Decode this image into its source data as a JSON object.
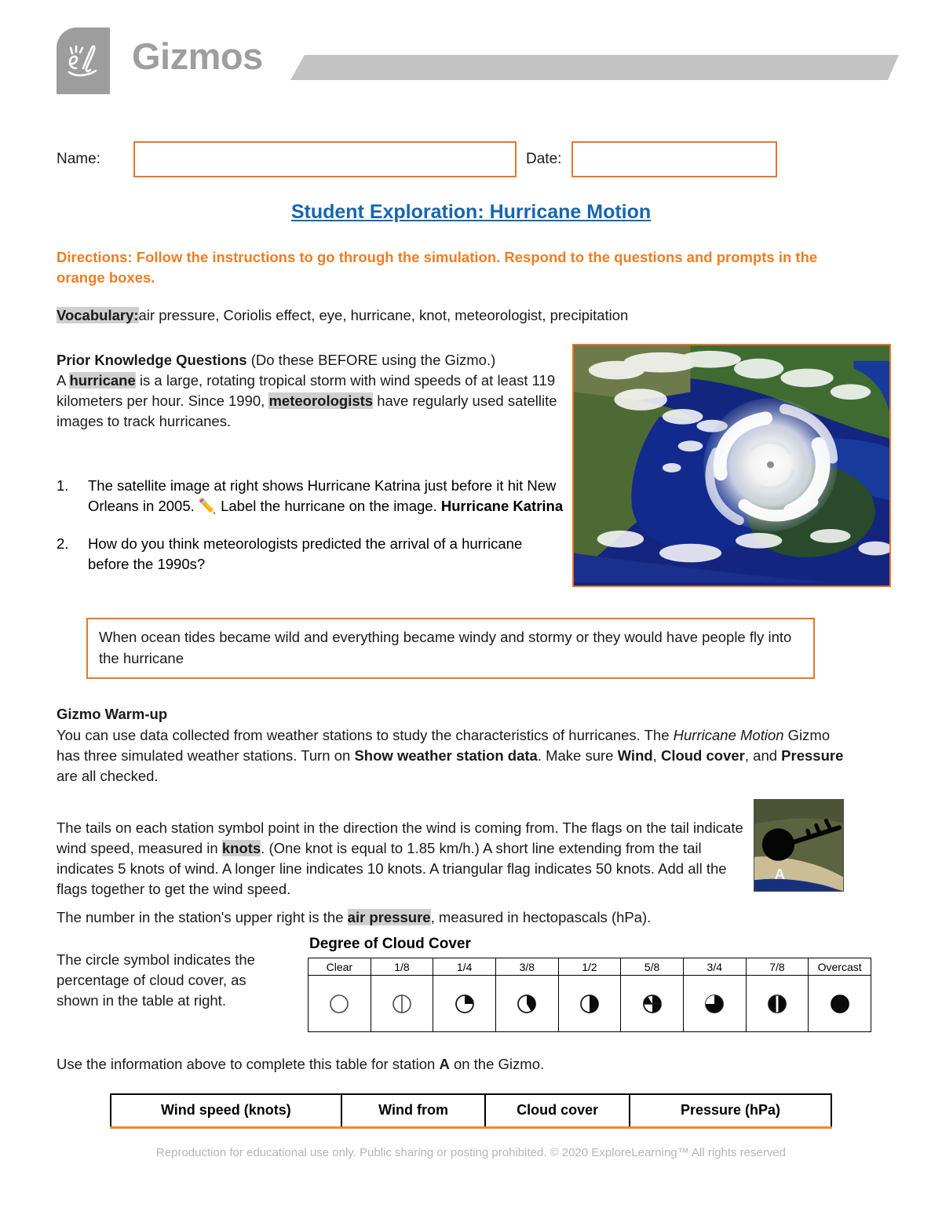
{
  "brand": {
    "logo_text": "Gizmos",
    "logo_mark_label": "el"
  },
  "fields": {
    "name_label": "Name:",
    "name_value": "",
    "date_label": "Date:",
    "date_value": ""
  },
  "title": "Student Exploration: Hurricane Motion",
  "directions": "Directions: Follow the instructions to go through the simulation. Respond to the questions and prompts in the orange boxes.",
  "vocabulary": {
    "label": "Vocabulary:",
    "terms": "air pressure, Coriolis effect, eye, hurricane, knot, meteorologist, precipitation"
  },
  "prior_knowledge": {
    "heading": "Prior Knowledge Questions",
    "heading_rest": " (Do these BEFORE using the Gizmo.)",
    "intro_a": "A ",
    "intro_hl1": "hurricane",
    "intro_b": " is a large, rotating tropical storm with wind speeds of at least 119 kilometers per hour. Since 1990, ",
    "intro_hl2": "meteorologists",
    "intro_c": " have regularly used satellite images to track hurricanes."
  },
  "questions": [
    {
      "num": "1.",
      "text_a": "The satellite image at right shows Hurricane Katrina just before it hit New Orleans in 2005. ",
      "icon": "pencil-icon",
      "text_b": " Label the hurricane on the image. ",
      "answer": "Hurricane Katrina"
    },
    {
      "num": "2.",
      "text_a": "How do you think meteorologists predicted the arrival of a hurricane before the 1990s?",
      "icon": "",
      "text_b": "",
      "answer": ""
    }
  ],
  "answer_box_2": "When ocean tides became wild and everything became windy and stormy or they would have people fly into the hurricane",
  "warmup": {
    "heading": "Gizmo Warm-up",
    "p1_a": "You can use data collected from weather stations to study the characteristics of hurricanes. The ",
    "p1_italic": "Hurricane Motion",
    "p1_b": " Gizmo has three simulated weather stations. Turn on ",
    "p1_bold1": "Show weather station data",
    "p1_c": ". Make sure ",
    "p1_bold2": "Wind",
    "p1_d": ", ",
    "p1_bold3": "Cloud cover",
    "p1_e": ", and ",
    "p1_bold4": "Pressure",
    "p1_f": " are all checked."
  },
  "tails": {
    "a": "The tails on each station symbol point in the direction the wind is coming from. The flags on the tail indicate wind speed, measured in ",
    "hl": "knots",
    "b": ". (One knot is equal to 1.85 km/h.) A short line extending from the tail indicates 5 knots of wind. A longer line indicates 10 knots. A triangular flag indicates 50 knots. Add all the flags together to get the wind speed."
  },
  "air_pressure_line": {
    "a": "The number in the station's upper right is the ",
    "hl": "air pressure",
    "b": ", measured in hectopascals (hPa)."
  },
  "circle_symbol_text": "The circle symbol indicates the percentage of cloud cover, as shown in the table at right.",
  "cloud_cover": {
    "title": "Degree of Cloud Cover",
    "headers": [
      "Clear",
      "1/8",
      "1/4",
      "3/8",
      "1/2",
      "5/8",
      "3/4",
      "7/8",
      "Overcast"
    ],
    "symbol_names": [
      "cloud-clear-icon",
      "cloud-one-eighth-icon",
      "cloud-one-quarter-icon",
      "cloud-three-eighths-icon",
      "cloud-one-half-icon",
      "cloud-five-eighths-icon",
      "cloud-three-quarters-icon",
      "cloud-seven-eighths-icon",
      "cloud-overcast-icon"
    ]
  },
  "use_table_line": {
    "a": "Use the information above to complete this table for station ",
    "bold": "A",
    "b": " on the Gizmo."
  },
  "station_table": {
    "headers": [
      "Wind speed (knots)",
      "Wind from",
      "Cloud cover",
      "Pressure (hPa)"
    ],
    "row": [
      "",
      "",
      "",
      ""
    ]
  },
  "station_thumb_label": "A",
  "footer": "Reproduction for educational use only. Public sharing or posting prohibited. © 2020 ExploreLearning™ All rights reserved",
  "colors": {
    "orange": "#e8762c",
    "orange_text": "#ef7d22",
    "title_blue": "#1666b0",
    "logo_gray": "#9d9d9d",
    "bar_gray": "#c3c3c3",
    "highlight_gray": "#cfcfcf",
    "footer_gray": "#b5b5b5"
  }
}
